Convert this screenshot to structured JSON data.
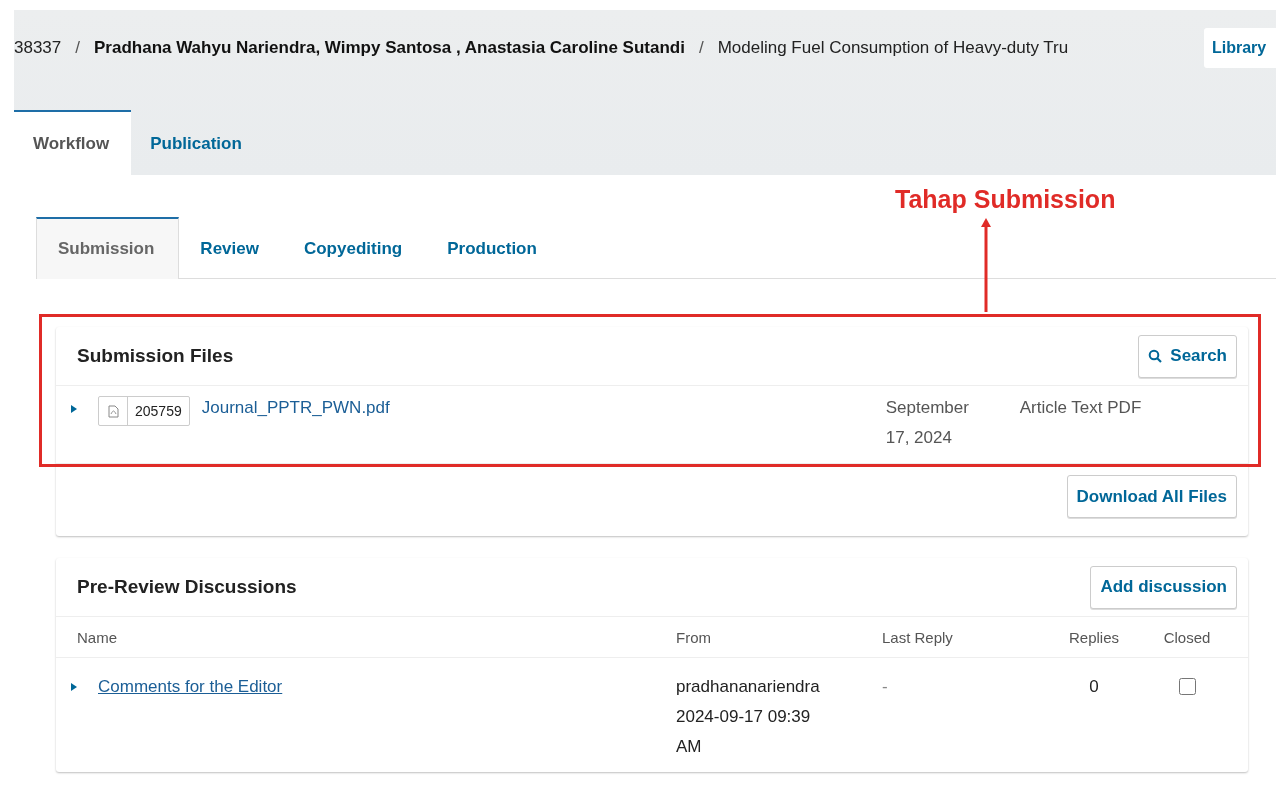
{
  "breadcrumb": {
    "id": "38337",
    "separators": [
      "/",
      "/"
    ],
    "authors": "Pradhana Wahyu Nariendra, Wimpy Santosa , Anastasia Caroline Sutandi",
    "title": "Modeling Fuel Consumption of Heavy-duty Tru",
    "button": "Library"
  },
  "tabs": [
    {
      "label": "Workflow",
      "selected": true
    },
    {
      "label": "Publication",
      "selected": false
    }
  ],
  "stage_tabs": [
    {
      "label": "Submission",
      "selected": true
    },
    {
      "label": "Review",
      "selected": false
    },
    {
      "label": "Copyediting",
      "selected": false
    },
    {
      "label": "Production",
      "selected": false
    }
  ],
  "annotation": {
    "label": "Tahap Submission"
  },
  "submission_files": {
    "title": "Submission Files",
    "search": "Search",
    "files": [
      {
        "expanded": false,
        "id": "205759",
        "name": "Journal_PPTR_PWN.pdf",
        "date": "September 17, 2024",
        "type": "Article Text PDF"
      }
    ],
    "download": "Download All Files"
  },
  "discussions": {
    "title": "Pre-Review Discussions",
    "add": "Add discussion",
    "columns": [
      "Name",
      "From",
      "Last Reply",
      "Replies",
      "Closed"
    ],
    "rows": [
      {
        "expanded": false,
        "name": "Comments for the Editor",
        "from": "pradhananariendra",
        "date": "2024-09-17 09:39 AM",
        "last_reply": "-",
        "replies": "0",
        "closed": false
      }
    ]
  }
}
